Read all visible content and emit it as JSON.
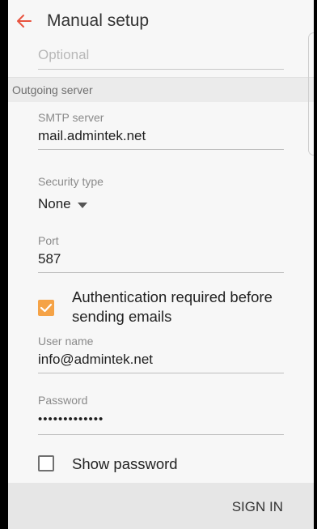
{
  "app": {
    "title": "Manual setup"
  },
  "incoming": {
    "optional_placeholder": "Optional"
  },
  "outgoing": {
    "section_label": "Outgoing server",
    "smtp_label": "SMTP server",
    "smtp_value": "mail.admintek.net",
    "security_label": "Security type",
    "security_value": "None",
    "port_label": "Port",
    "port_value": "587",
    "auth_label": "Authentication required before sending emails",
    "auth_checked": true,
    "username_label": "User name",
    "username_value": "info@admintek.net",
    "password_label": "Password",
    "password_value": "•••••••••••••",
    "show_password_label": "Show password",
    "show_password_checked": false
  },
  "actions": {
    "sign_in_label": "SIGN IN"
  },
  "colors": {
    "accent": "#f5a347",
    "back_arrow": "#e8533f"
  }
}
